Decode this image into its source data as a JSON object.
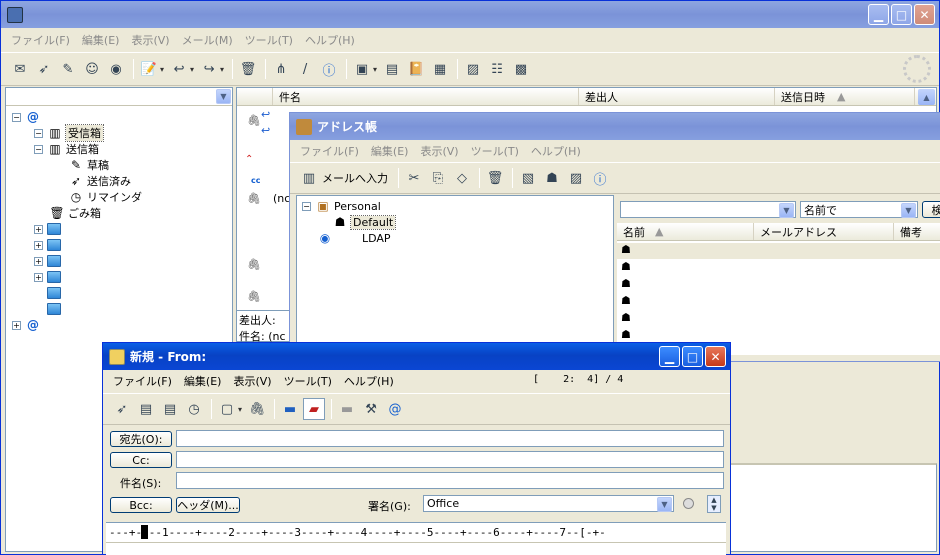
{
  "main": {
    "title": "",
    "menu": [
      "ファイル(F)",
      "編集(E)",
      "表示(V)",
      "メール(M)",
      "ツール(T)",
      "ヘルプ(H)"
    ],
    "columns": [
      "件名",
      "差出人",
      "送信日時"
    ],
    "tree": [
      {
        "label": "受信箱"
      },
      {
        "label": "送信箱"
      },
      {
        "label": "草稿"
      },
      {
        "label": "送信済み"
      },
      {
        "label": "リマインダ"
      },
      {
        "label": "ごみ箱"
      }
    ],
    "preview": {
      "from_label": "差出人:",
      "subject_label": "件名:",
      "subject_value": "(nc"
    },
    "row_fragment": "(nc"
  },
  "addressbook": {
    "title": "アドレス帳",
    "menu": [
      "ファイル(F)",
      "編集(E)",
      "表示(V)",
      "ツール(T)",
      "ヘルプ(H)"
    ],
    "mail_button": "メールへ入力",
    "tree": {
      "personal": "Personal",
      "default": "Default",
      "ldap": "LDAP"
    },
    "search_placeholder": "",
    "sort_select": "名前で",
    "search_button": "検",
    "columns": [
      "名前",
      "メールアドレス",
      "備考"
    ]
  },
  "compose": {
    "title": "新規 - From:",
    "menu": [
      "ファイル(F)",
      "編集(E)",
      "表示(V)",
      "ツール(T)",
      "ヘルプ(H)"
    ],
    "position": "[    2:  4] / 4",
    "to_button": "宛先(O):",
    "cc_button": "Cc:",
    "subject_label": "件名(S):",
    "bcc_button": "Bcc:",
    "header_button": "ヘッダ(M)...",
    "signature_label": "署名(G):",
    "signature_value": "Office",
    "ruler": "---+----1----+----2----+----3----+----4----+----5----+----6----+----7--[-+-"
  }
}
